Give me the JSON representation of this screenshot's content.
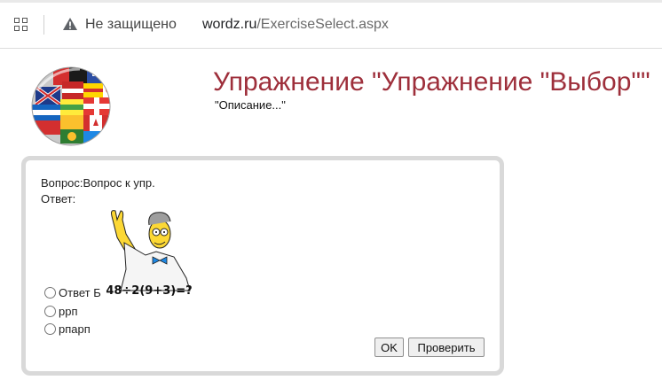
{
  "browser": {
    "security_text": "Не защищено",
    "url_host": "wordz.ru",
    "url_path": "/ExerciseSelect.aspx",
    "icons": [
      "tabs-icon",
      "warning-icon"
    ]
  },
  "header": {
    "title": "Упражнение \"Упражнение \"Выбор\"\"",
    "subtitle": "\"Описание...\"",
    "logo": "flags-globe-logo"
  },
  "exercise": {
    "question": "Вопрос:Вопрос к упр.",
    "answer_label": "Ответ:",
    "image": "professor-math-puzzle",
    "image_text": "48÷2(9+3)=?",
    "options": [
      {
        "label": "Ответ Б",
        "checked": false
      },
      {
        "label": "ррп",
        "checked": false
      },
      {
        "label": "рпарп",
        "checked": false
      }
    ],
    "ok_label": "OK",
    "check_label": "Проверить"
  },
  "colors": {
    "title": "#9e2f3b",
    "panel_border": "#d9d9d9"
  }
}
